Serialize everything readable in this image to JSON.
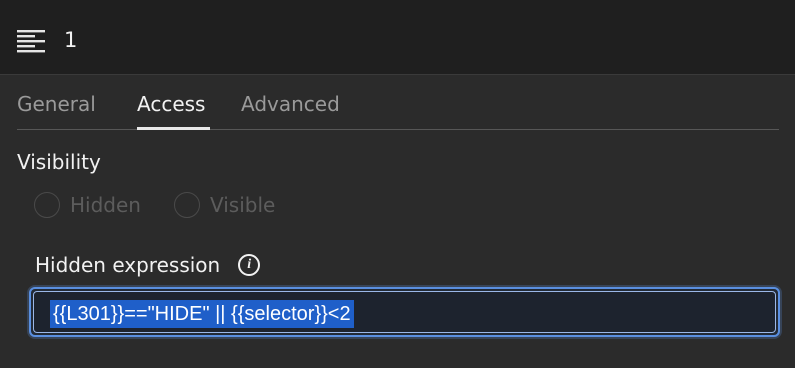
{
  "header": {
    "icon": "align-left-icon",
    "title": "1"
  },
  "tabs": [
    {
      "label": "General",
      "active": false
    },
    {
      "label": "Access",
      "active": true
    },
    {
      "label": "Advanced",
      "active": false
    }
  ],
  "visibility": {
    "label": "Visibility",
    "options": [
      {
        "label": "Hidden",
        "selected": false,
        "disabled": true
      },
      {
        "label": "Visible",
        "selected": false,
        "disabled": true
      }
    ]
  },
  "expression": {
    "label": "Hidden expression",
    "info_icon": "info-icon",
    "value": "{{L301}}==\"HIDE\" || {{selector}}<2",
    "selected": true
  },
  "colors": {
    "header_bg": "#1f1f1f",
    "panel_bg": "#2b2b2b",
    "focus_border": "#5a8fe0",
    "selection": "#1f5fc9"
  }
}
